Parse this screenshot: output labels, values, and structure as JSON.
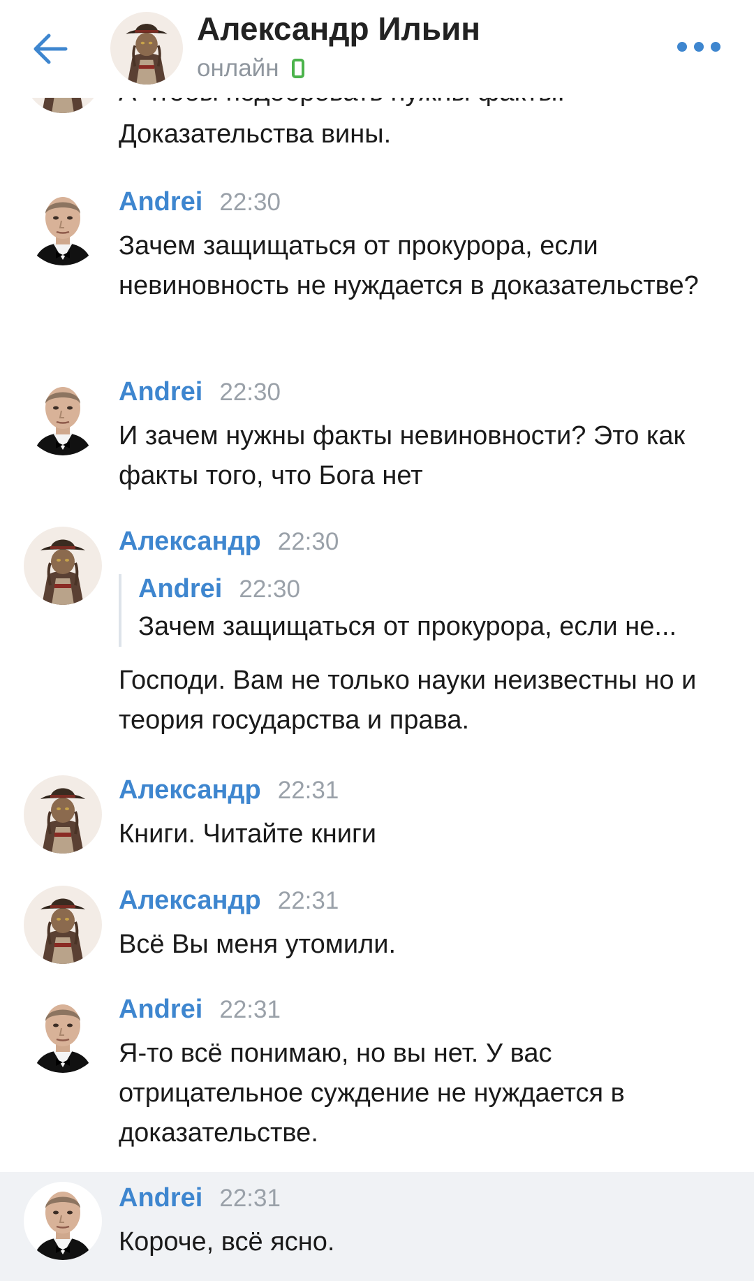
{
  "header": {
    "name": "Александр Ильин",
    "status": "онлайн"
  },
  "colors": {
    "accent": "#3e86cf",
    "online": "#4bb34b",
    "highlight_row": "#f0f2f5"
  },
  "partial_message": {
    "line_cut": "А чтобы подобревать нужны факты.",
    "line_visible": "Доказательства вины."
  },
  "messages": [
    {
      "author": "Andrei",
      "time": "22:30",
      "text": "Зачем защищаться от прокурора, если невиновность не нуждается в доказательстве?"
    },
    {
      "author": "Andrei",
      "time": "22:30",
      "text": "И зачем нужны факты невиновности? Это как факты того, что Бога нет"
    },
    {
      "author": "Александр",
      "time": "22:30",
      "reply_author": "Andrei",
      "reply_time": "22:30",
      "reply_text": "Зачем защищаться от прокурора, если не...",
      "text": "Господи. Вам не только науки неизвестны но и теория государства и права."
    },
    {
      "author": "Александр",
      "time": "22:31",
      "text": "Книги. Читайте книги"
    },
    {
      "author": "Александр",
      "time": "22:31",
      "text": "Всё Вы меня утомили."
    },
    {
      "author": "Andrei",
      "time": "22:31",
      "text": "Я-то всё понимаю, но вы нет. У вас отрицательное суждение не нуждается в доказательстве."
    },
    {
      "author": "Andrei",
      "time": "22:31",
      "text": "Короче, всё ясно."
    }
  ]
}
